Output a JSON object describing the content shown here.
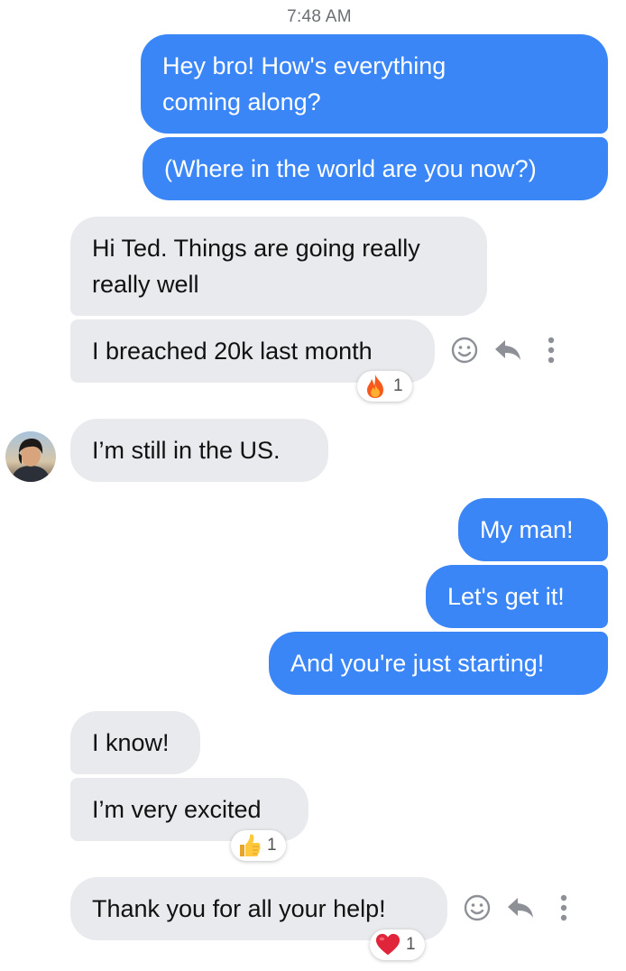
{
  "timestamp": "7:48 AM",
  "colors": {
    "outgoing_bubble": "#3b86f7",
    "incoming_bubble": "#e9eaed",
    "outgoing_text": "#ffffff",
    "incoming_text": "#111111",
    "timestamp_text": "#6b6e73"
  },
  "messages": [
    {
      "direction": "outgoing",
      "lines": [
        "Hey bro! How's everything",
        "coming along?"
      ]
    },
    {
      "direction": "outgoing",
      "text": "(Where in the world are you now?)"
    },
    {
      "direction": "incoming",
      "lines": [
        "Hi Ted. Things are going really",
        "really well"
      ]
    },
    {
      "direction": "incoming",
      "text": "I breached 20k last month",
      "reaction": {
        "icon": "fire-emoji",
        "count": "1"
      }
    },
    {
      "direction": "incoming",
      "text": "I’m still in the US."
    },
    {
      "direction": "outgoing",
      "text": "My man!"
    },
    {
      "direction": "outgoing",
      "text": "Let's get it!"
    },
    {
      "direction": "outgoing",
      "text": "And you're just starting!"
    },
    {
      "direction": "incoming",
      "text": "I know!"
    },
    {
      "direction": "incoming",
      "text": "I’m very excited",
      "reaction": {
        "icon": "thumbs-up-emoji",
        "count": "1"
      }
    },
    {
      "direction": "incoming",
      "text": "Thank you for all your help!",
      "reaction": {
        "icon": "red-heart-emoji",
        "count": "1"
      }
    }
  ],
  "message_actions": [
    "smiley-react-icon",
    "reply-arrow-icon",
    "more-vertical-icon"
  ]
}
